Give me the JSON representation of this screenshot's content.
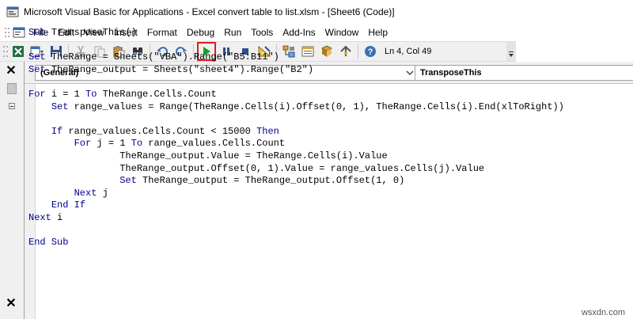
{
  "window": {
    "title": "Microsoft Visual Basic for Applications - Excel convert table to list.xlsm - [Sheet6 (Code)]"
  },
  "menu": {
    "items": [
      "File",
      "Edit",
      "View",
      "Insert",
      "Format",
      "Debug",
      "Run",
      "Tools",
      "Add-Ins",
      "Window",
      "Help"
    ]
  },
  "toolbar": {
    "status": "Ln 4, Col 49",
    "icons": [
      "excel-icon",
      "insert-module-icon",
      "save-icon",
      "cut-icon",
      "copy-icon",
      "paste-icon",
      "find-icon",
      "undo-icon",
      "redo-icon",
      "run-icon",
      "break-icon",
      "reset-icon",
      "design-mode-icon",
      "project-explorer-icon",
      "properties-icon",
      "object-browser-icon",
      "toolbox-icon",
      "help-icon"
    ]
  },
  "code_window": {
    "object_combo": "(General)",
    "procedure_combo": "TransposeThis"
  },
  "code": {
    "lines": [
      [
        {
          "t": "Sub ",
          "k": true
        },
        {
          "t": "TransposeThis()"
        }
      ],
      [],
      [
        {
          "t": "Set ",
          "k": true
        },
        {
          "t": "TheRange = Sheets(\"VBA\").Range(\"B5:B11\")"
        }
      ],
      [
        {
          "t": "Set ",
          "k": true
        },
        {
          "t": "TheRange_output = Sheets(\"sheet4\").Range(\"B2\")"
        }
      ],
      [],
      [
        {
          "t": "For ",
          "k": true
        },
        {
          "t": "i = 1 "
        },
        {
          "t": "To ",
          "k": true
        },
        {
          "t": "TheRange.Cells.Count"
        }
      ],
      [
        {
          "t": "    "
        },
        {
          "t": "Set ",
          "k": true
        },
        {
          "t": "range_values = Range(TheRange.Cells(i).Offset(0, 1), TheRange.Cells(i).End(xlToRight))"
        }
      ],
      [],
      [
        {
          "t": "    "
        },
        {
          "t": "If ",
          "k": true
        },
        {
          "t": "range_values.Cells.Count < 15000 "
        },
        {
          "t": "Then",
          "k": true
        }
      ],
      [
        {
          "t": "        "
        },
        {
          "t": "For ",
          "k": true
        },
        {
          "t": "j = 1 "
        },
        {
          "t": "To ",
          "k": true
        },
        {
          "t": "range_values.Cells.Count"
        }
      ],
      [
        {
          "t": "                TheRange_output.Value = TheRange.Cells(i).Value"
        }
      ],
      [
        {
          "t": "                TheRange_output.Offset(0, 1).Value = range_values.Cells(j).Value"
        }
      ],
      [
        {
          "t": "                "
        },
        {
          "t": "Set ",
          "k": true
        },
        {
          "t": "TheRange_output = TheRange_output.Offset(1, 0)"
        }
      ],
      [
        {
          "t": "        "
        },
        {
          "t": "Next ",
          "k": true
        },
        {
          "t": "j"
        }
      ],
      [
        {
          "t": "    "
        },
        {
          "t": "End If",
          "k": true
        }
      ],
      [
        {
          "t": "Next ",
          "k": true
        },
        {
          "t": "i"
        }
      ],
      [],
      [
        {
          "t": "End Sub",
          "k": true
        }
      ]
    ]
  },
  "watermark": "wsxdn.com"
}
